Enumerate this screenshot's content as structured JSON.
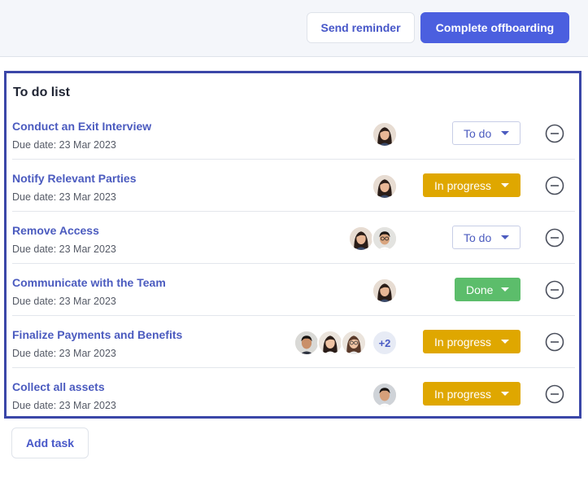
{
  "header": {
    "send_reminder_label": "Send reminder",
    "complete_offboarding_label": "Complete offboarding"
  },
  "todo": {
    "title": "To do list",
    "tasks": [
      {
        "name": "Conduct an Exit Interview",
        "due": "Due date: 23 Mar 2023",
        "status": "To do",
        "assignees": [
          "woman-avatar"
        ],
        "extra": ""
      },
      {
        "name": "Notify Relevant Parties",
        "due": "Due date: 23 Mar 2023",
        "status": "In progress",
        "assignees": [
          "woman-avatar"
        ],
        "extra": ""
      },
      {
        "name": "Remove Access",
        "due": "Due date: 23 Mar 2023",
        "status": "To do",
        "assignees": [
          "woman-avatar",
          "man-glasses-avatar"
        ],
        "extra": ""
      },
      {
        "name": "Communicate with the Team",
        "due": "Due date: 23 Mar 2023",
        "status": "Done",
        "assignees": [
          "woman-avatar"
        ],
        "extra": ""
      },
      {
        "name": "Finalize Payments and Benefits",
        "due": "Due date: 23 Mar 2023",
        "status": "In progress",
        "assignees": [
          "man-avatar",
          "woman-avatar",
          "woman-glasses-avatar"
        ],
        "extra": "+2"
      },
      {
        "name": "Collect all assets",
        "due": "Due date: 23 Mar 2023",
        "status": "In progress",
        "assignees": [
          "man-avatar"
        ],
        "extra": ""
      }
    ],
    "add_task_label": "Add task"
  },
  "colors": {
    "primary": "#4b5fdf",
    "in_progress": "#dfa700",
    "done": "#5cbd6b",
    "panel_border": "#3b47a8"
  }
}
